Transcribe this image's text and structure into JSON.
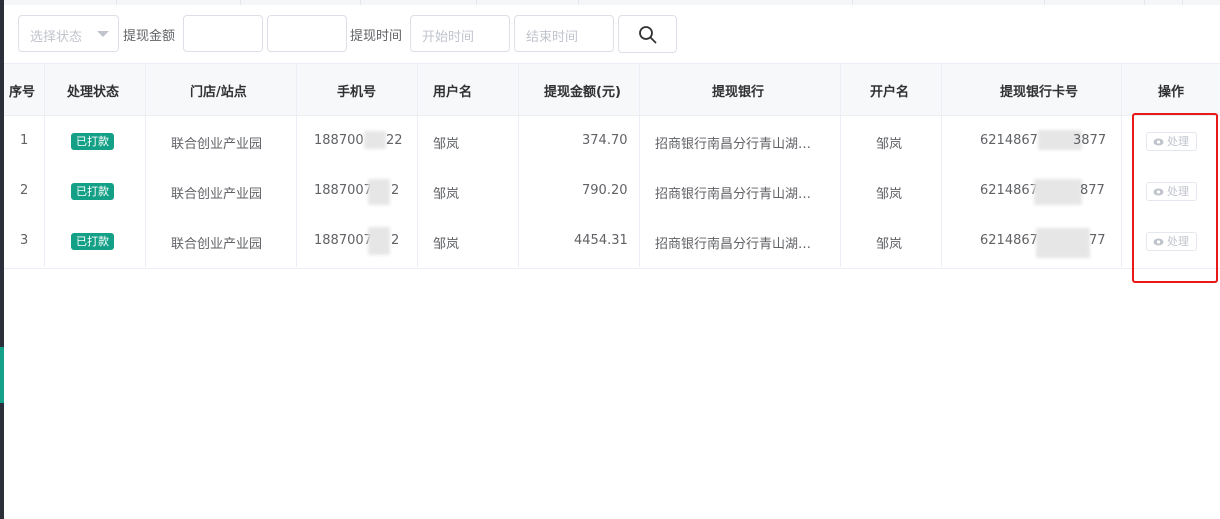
{
  "filters": {
    "status_placeholder": "选择状态",
    "amount_label": "提现金额",
    "amount_min_value": "",
    "amount_max_value": "",
    "time_label": "提现时间",
    "start_placeholder": "开始时间",
    "end_placeholder": "结束时间"
  },
  "table": {
    "columns": [
      "序号",
      "处理状态",
      "门店/站点",
      "手机号",
      "用户名",
      "提现金额(元)",
      "提现银行",
      "开户名",
      "提现银行卡号",
      "操作"
    ],
    "rows": [
      {
        "index": "1",
        "status": "已打款",
        "store": "联合创业产业园",
        "phone": "18870022",
        "phone_left": "188700",
        "phone_right": "22",
        "user": "邹岚",
        "amount": "374.70",
        "bank": "招商银行南昌分行青山湖…",
        "holder": "邹岚",
        "card": "621486738877",
        "card_left": "6214867",
        "card_right": "3877",
        "action": "处理"
      },
      {
        "index": "2",
        "status": "已打款",
        "store": "联合创业产业园",
        "phone": "1887007…2",
        "phone_left": "1887007",
        "phone_right": "2",
        "user": "邹岚",
        "amount": "790.20",
        "bank": "招商银行南昌分行青山湖…",
        "holder": "邹岚",
        "card": "6214867…877",
        "card_left": "6214867",
        "card_right": "877",
        "action": "处理"
      },
      {
        "index": "3",
        "status": "已打款",
        "store": "联合创业产业园",
        "phone": "1887007…2",
        "phone_left": "1887007",
        "phone_right": "2",
        "user": "邹岚",
        "amount": "4454.31",
        "bank": "招商银行南昌分行青山湖…",
        "holder": "邹岚",
        "card": "6214867…77",
        "card_left": "6214867",
        "card_right": "77",
        "action": "处理"
      }
    ]
  },
  "colors": {
    "accent": "#13a086",
    "highlight": "#e81818"
  },
  "icons": {
    "search": "search-icon",
    "eye": "eye-icon",
    "dropdown": "chevron-down-icon"
  }
}
